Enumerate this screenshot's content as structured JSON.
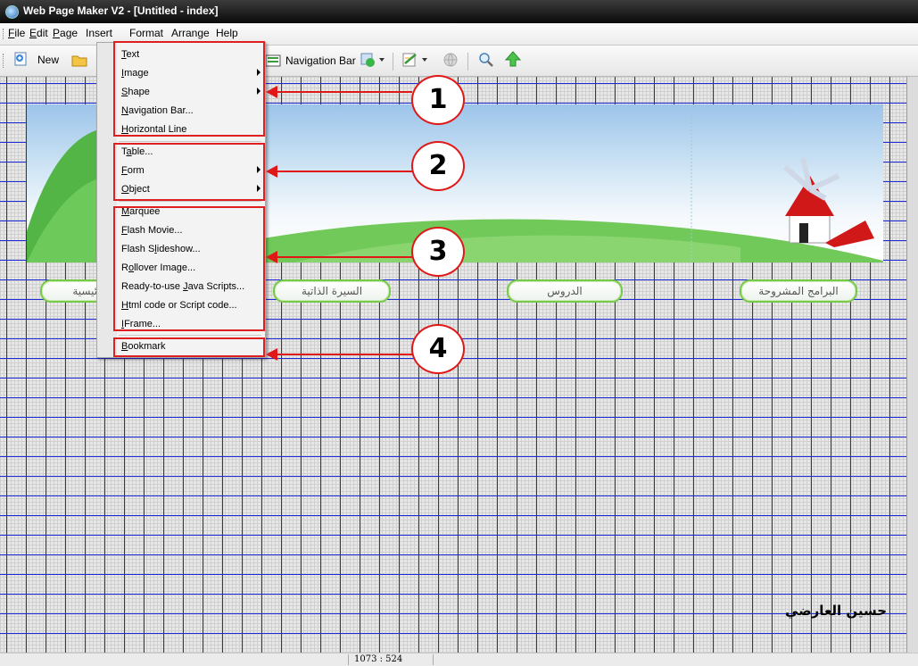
{
  "window": {
    "title": "Web Page Maker V2 - [Untitled - index]"
  },
  "menubar": {
    "items": [
      {
        "label": "File",
        "key": "F",
        "rest": "ile"
      },
      {
        "label": "Edit",
        "key": "E",
        "rest": "dit"
      },
      {
        "label": "Page",
        "key": "P",
        "rest": "age"
      },
      {
        "label": "Insert",
        "key": "",
        "rest": "Insert"
      },
      {
        "label": "Format",
        "key": "",
        "rest": "Format"
      },
      {
        "label": "Arrange",
        "key": "",
        "rest": "Arrange"
      },
      {
        "label": "Help",
        "key": "",
        "rest": "Help"
      }
    ]
  },
  "toolbar": {
    "new_label": "New",
    "navbar_label": "Navigation Bar"
  },
  "insert_menu": {
    "groups": [
      {
        "items": [
          {
            "label": "Text",
            "key": "T",
            "rest": "ext",
            "submenu": false
          },
          {
            "label": "Image",
            "key": "I",
            "rest": "mage",
            "submenu": true
          },
          {
            "label": "Shape",
            "key": "S",
            "rest": "hape",
            "submenu": true
          },
          {
            "label": "Navigation Bar...",
            "key": "N",
            "rest": "avigation Bar...",
            "submenu": false
          },
          {
            "label": "Horizontal Line",
            "key": "H",
            "rest": "orizontal Line",
            "submenu": false
          }
        ]
      },
      {
        "items": [
          {
            "label": "Table...",
            "pre": "T",
            "key": "a",
            "rest": "ble...",
            "submenu": false
          },
          {
            "label": "Form",
            "key": "F",
            "rest": "orm",
            "submenu": true
          },
          {
            "label": "Object",
            "key": "O",
            "rest": "bject",
            "submenu": true
          }
        ]
      },
      {
        "items": [
          {
            "label": "Marquee",
            "key": "M",
            "rest": "arquee",
            "submenu": false
          },
          {
            "label": "Flash Movie...",
            "key": "F",
            "rest": "lash Movie...",
            "submenu": false
          },
          {
            "label": "Flash Slideshow...",
            "pre": "Flash S",
            "key": "l",
            "rest": "ideshow...",
            "submenu": false
          },
          {
            "label": "Rollover Image...",
            "pre": "R",
            "key": "o",
            "rest": "llover Image...",
            "submenu": false
          },
          {
            "label": "Ready-to-use Java Scripts...",
            "pre": "Ready-to-use ",
            "key": "J",
            "rest": "ava Scripts...",
            "submenu": false
          },
          {
            "label": "Html code or Script code...",
            "key": "H",
            "rest": "tml code or Script code...",
            "submenu": false
          },
          {
            "label": "IFrame...",
            "key": "I",
            "rest": "Frame...",
            "submenu": false
          }
        ]
      },
      {
        "items": [
          {
            "label": "Bookmark",
            "key": "B",
            "rest": "ookmark",
            "submenu": false
          }
        ]
      }
    ]
  },
  "annotations": [
    "1",
    "2",
    "3",
    "4"
  ],
  "page": {
    "nav_buttons": [
      "الرئيسية",
      "السيرة الذاتية",
      "الدروس",
      "البرامج المشروحة"
    ],
    "signature": "حسين العارضي"
  },
  "status": {
    "coords": "1073 : 524"
  },
  "colors": {
    "grid": "#1c2bd8",
    "annotation": "#e01818",
    "nav_border": "#78c84a"
  }
}
